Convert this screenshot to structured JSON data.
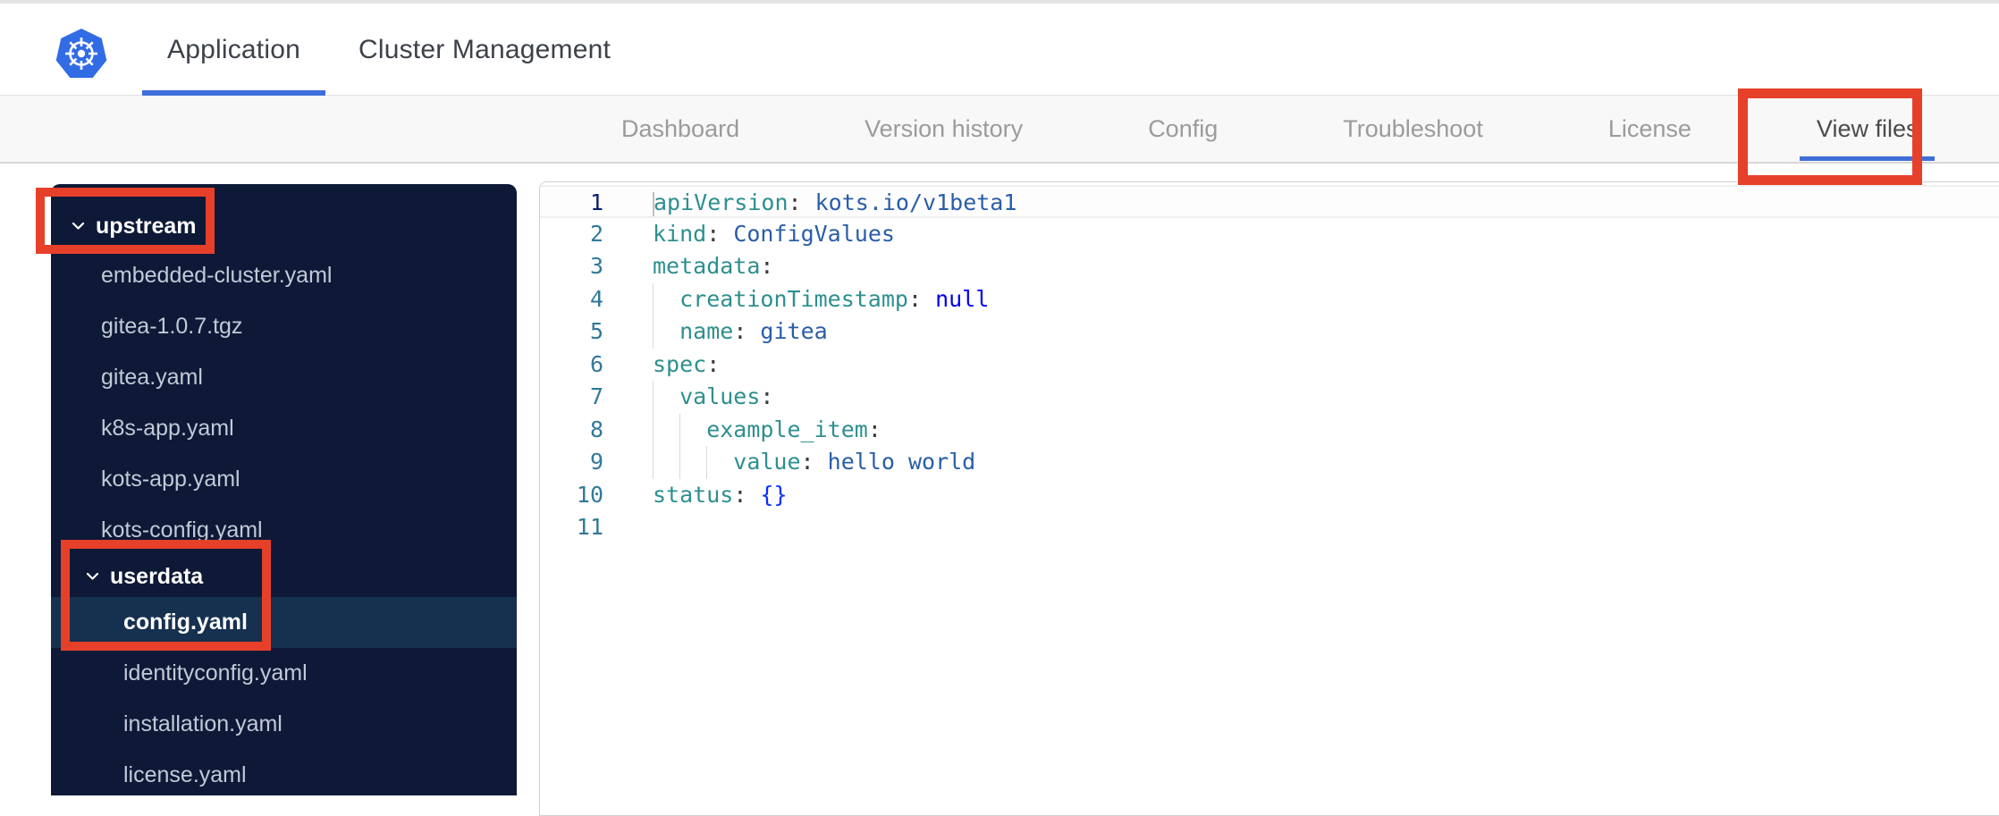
{
  "navbar": {
    "tabs": [
      {
        "label": "Application",
        "active": true
      },
      {
        "label": "Cluster Management",
        "active": false
      }
    ]
  },
  "subnav": {
    "tabs": [
      {
        "label": "Dashboard",
        "active": false
      },
      {
        "label": "Version history",
        "active": false
      },
      {
        "label": "Config",
        "active": false
      },
      {
        "label": "Troubleshoot",
        "active": false
      },
      {
        "label": "License",
        "active": false
      },
      {
        "label": "View files",
        "active": true
      }
    ]
  },
  "file_tree": {
    "items": [
      {
        "type": "folder",
        "label": "upstream",
        "level": 0,
        "expanded": true,
        "selected": false
      },
      {
        "type": "file",
        "label": "embedded-cluster.yaml",
        "level": 1,
        "selected": false
      },
      {
        "type": "file",
        "label": "gitea-1.0.7.tgz",
        "level": 1,
        "selected": false
      },
      {
        "type": "file",
        "label": "gitea.yaml",
        "level": 1,
        "selected": false
      },
      {
        "type": "file",
        "label": "k8s-app.yaml",
        "level": 1,
        "selected": false
      },
      {
        "type": "file",
        "label": "kots-app.yaml",
        "level": 1,
        "selected": false
      },
      {
        "type": "file",
        "label": "kots-config.yaml",
        "level": 1,
        "selected": false
      },
      {
        "type": "folder",
        "label": "userdata",
        "level": 1,
        "expanded": true,
        "selected": false
      },
      {
        "type": "file",
        "label": "config.yaml",
        "level": 2,
        "selected": true
      },
      {
        "type": "file",
        "label": "identityconfig.yaml",
        "level": 2,
        "selected": false
      },
      {
        "type": "file",
        "label": "installation.yaml",
        "level": 2,
        "selected": false
      },
      {
        "type": "file",
        "label": "license.yaml",
        "level": 2,
        "selected": false
      }
    ]
  },
  "editor": {
    "cursor_line": 1,
    "lines": [
      {
        "num": 1,
        "current": true,
        "indent": 0,
        "tokens": [
          [
            "key",
            "apiVersion"
          ],
          [
            "pun",
            ": "
          ],
          [
            "str",
            "kots.io/v1beta1"
          ]
        ]
      },
      {
        "num": 2,
        "current": false,
        "indent": 0,
        "tokens": [
          [
            "key",
            "kind"
          ],
          [
            "pun",
            ": "
          ],
          [
            "str",
            "ConfigValues"
          ]
        ]
      },
      {
        "num": 3,
        "current": false,
        "indent": 0,
        "tokens": [
          [
            "key",
            "metadata"
          ],
          [
            "pun",
            ":"
          ]
        ]
      },
      {
        "num": 4,
        "current": false,
        "indent": 1,
        "tokens": [
          [
            "key",
            "creationTimestamp"
          ],
          [
            "pun",
            ": "
          ],
          [
            "kw",
            "null"
          ]
        ]
      },
      {
        "num": 5,
        "current": false,
        "indent": 1,
        "tokens": [
          [
            "key",
            "name"
          ],
          [
            "pun",
            ": "
          ],
          [
            "str",
            "gitea"
          ]
        ]
      },
      {
        "num": 6,
        "current": false,
        "indent": 0,
        "tokens": [
          [
            "key",
            "spec"
          ],
          [
            "pun",
            ":"
          ]
        ]
      },
      {
        "num": 7,
        "current": false,
        "indent": 1,
        "tokens": [
          [
            "key",
            "values"
          ],
          [
            "pun",
            ":"
          ]
        ]
      },
      {
        "num": 8,
        "current": false,
        "indent": 2,
        "tokens": [
          [
            "key",
            "example_item"
          ],
          [
            "pun",
            ":"
          ]
        ]
      },
      {
        "num": 9,
        "current": false,
        "indent": 3,
        "tokens": [
          [
            "key",
            "value"
          ],
          [
            "pun",
            ": "
          ],
          [
            "str",
            "hello world"
          ]
        ]
      },
      {
        "num": 10,
        "current": false,
        "indent": 0,
        "tokens": [
          [
            "key",
            "status"
          ],
          [
            "pun",
            ": "
          ],
          [
            "brc",
            "{}"
          ]
        ]
      },
      {
        "num": 11,
        "current": false,
        "indent": 0,
        "tokens": []
      }
    ]
  },
  "annotations": {
    "color": "#e6402a",
    "boxes": [
      {
        "name": "view-files",
        "target": "View files tab"
      },
      {
        "name": "upstream",
        "target": "upstream folder"
      },
      {
        "name": "userdata-config",
        "target": "userdata folder and config.yaml file"
      }
    ]
  },
  "icons": {
    "logo": "kubernetes-logo",
    "folder_chevron": "chevron-down-icon"
  },
  "colors": {
    "brand_blue": "#326ce5",
    "accent_underline": "#3e6fd9",
    "annotation_red": "#e6402a",
    "sidebar_bg": "#0d1937",
    "sidebar_selected_bg": "#16304f",
    "code_key": "#2e8f8f",
    "code_value": "#2a5da8",
    "code_keyword": "#0000ee",
    "line_number": "#31799c"
  }
}
